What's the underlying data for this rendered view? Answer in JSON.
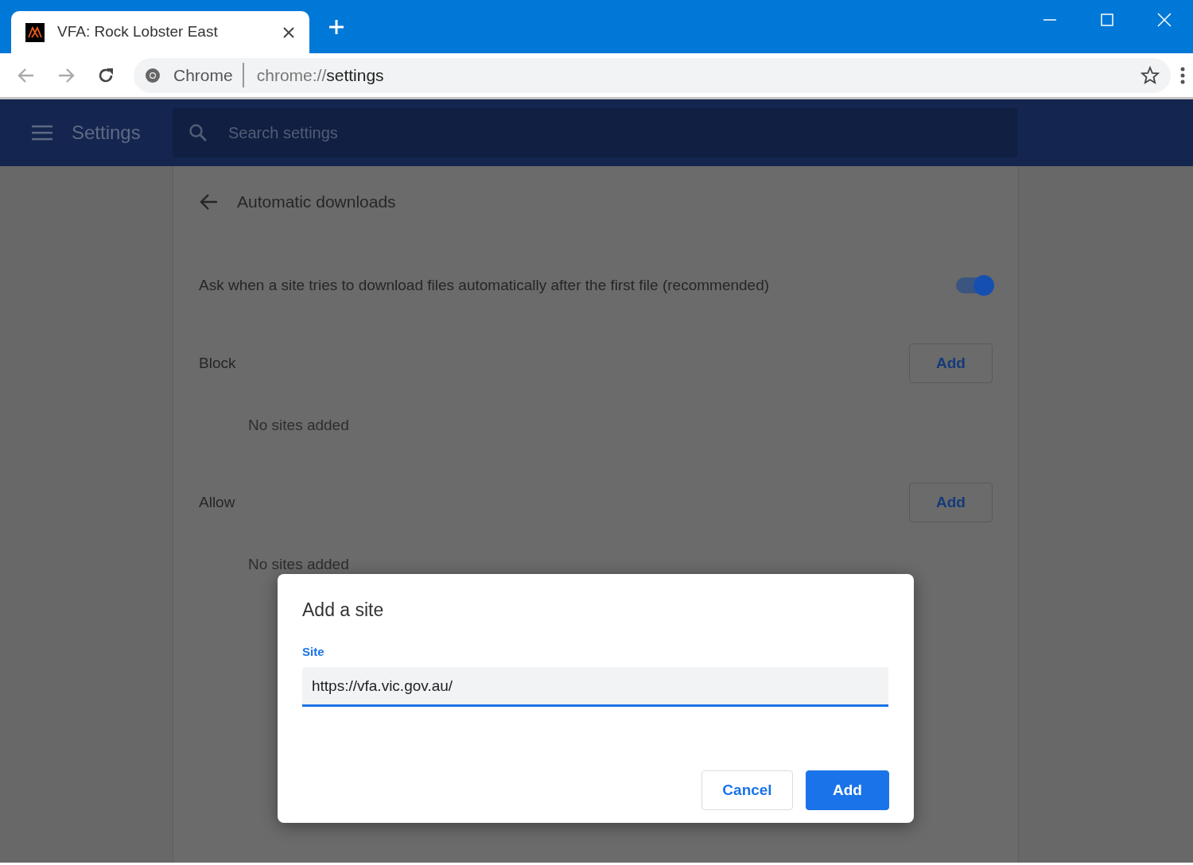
{
  "browser": {
    "tab": {
      "title": "VFA: Rock Lobster East"
    },
    "address": {
      "chip": "Chrome",
      "url_scheme": "chrome://",
      "url_path": "settings"
    }
  },
  "settings": {
    "title": "Settings",
    "search": {
      "placeholder": "Search settings"
    }
  },
  "page": {
    "title": "Automatic downloads",
    "toggle": {
      "label": "Ask when a site tries to download files automatically after the first file (recommended)",
      "on": true
    },
    "sections": [
      {
        "title": "Block",
        "button": "Add",
        "empty": "No sites added"
      },
      {
        "title": "Allow",
        "button": "Add",
        "empty": "No sites added"
      }
    ]
  },
  "dialog": {
    "title": "Add a site",
    "field": {
      "label": "Site",
      "value": "https://vfa.vic.gov.au/"
    },
    "buttons": [
      {
        "label": "Cancel",
        "kind": "secondary"
      },
      {
        "label": "Add",
        "kind": "primary"
      }
    ]
  }
}
